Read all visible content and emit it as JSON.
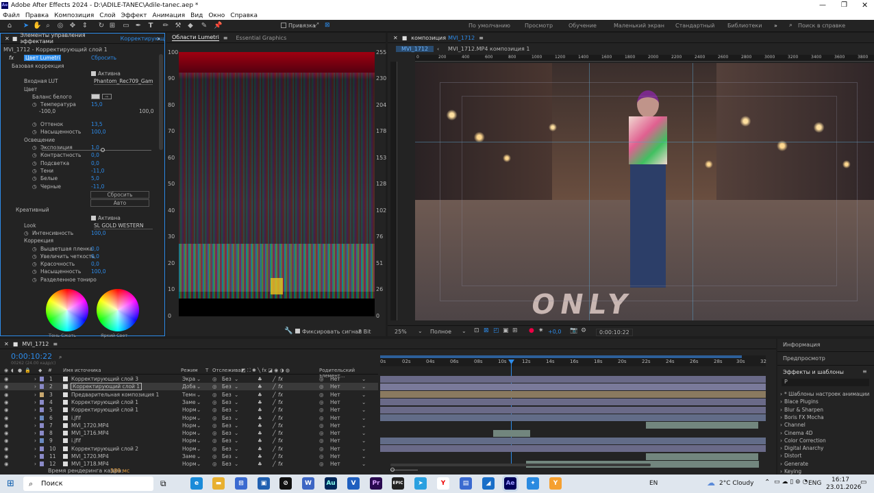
{
  "titlebar": {
    "title": "Adobe After Effects 2024 - D:\\ADILE-TANEC\\Adile-tanec.aep *"
  },
  "menu": [
    "Файл",
    "Правка",
    "Композиция",
    "Слой",
    "Эффект",
    "Анимация",
    "Вид",
    "Окно",
    "Справка"
  ],
  "toolbar": {
    "snap_label": "Привязка",
    "workspaces": [
      "По умолчанию",
      "Просмотр",
      "Обучение",
      "Маленький экран",
      "Стандартный",
      "Библиотеки"
    ],
    "help_placeholder": "Поиск в справке"
  },
  "effects_panel": {
    "tab": "Элементы управления эффектами",
    "tab_suffix": "Корректирующ",
    "layer": "MVI_1712 - Корректирующий слой 1",
    "effect_name": "Цвет Lumetri",
    "reset": "Сбросить",
    "basic": "Базовая коррекция",
    "active": "Активна",
    "input_lut": "Входная LUT",
    "lut_value": "Phantom_Rec709_Gam",
    "color": "Цвет",
    "white_balance": "Баланс белого",
    "temperature": "Температура",
    "temperature_val": "15,0",
    "range_min": "-100,0",
    "range_max": "100,0",
    "tint": "Оттенок",
    "tint_val": "13,5",
    "saturation": "Насыщенность",
    "saturation_val": "100,0",
    "lighting": "Освещение",
    "exposure": "Экспозиция",
    "exposure_val": "1,0",
    "contrast": "Контрастность",
    "contrast_val": "0,0",
    "highlights": "Подсветка",
    "highlights_val": "0,0",
    "shadows": "Тени",
    "shadows_val": "-11,0",
    "whites": "Белые",
    "whites_val": "5,0",
    "blacks": "Черные",
    "blacks_val": "-11,0",
    "reset_btn": "Сбросить",
    "auto_btn": "Авто",
    "creative": "Креативный",
    "active2": "Активна",
    "look": "Look",
    "look_val": "SL GOLD WESTERN",
    "intensity": "Интенсивность",
    "intensity_val": "100,0",
    "correction": "Коррекция",
    "faded": "Выцветшая пленка",
    "faded_val": "0,0",
    "sharpen": "Увеличить четкость",
    "sharpen_val": "0,0",
    "vibrance": "Красочность",
    "vibrance_val": "0,0",
    "saturation2": "Насыщенность",
    "saturation2_val": "100,0",
    "split": "Разделенное тониро",
    "wheel1": "Тень Сжать",
    "wheel2": "Яркий Свет"
  },
  "scopes": {
    "tabs": [
      "Области Lumetri",
      "Essential Graphics"
    ],
    "left_scale": [
      "100",
      "90",
      "80",
      "70",
      "60",
      "50",
      "40",
      "30",
      "20",
      "10",
      "0"
    ],
    "right_scale": [
      "255",
      "230",
      "204",
      "178",
      "153",
      "128",
      "102",
      "76",
      "51",
      "26",
      "0"
    ],
    "fix_signal": "Фиксировать сигнал",
    "bit": "8 Bit"
  },
  "comp": {
    "tab_prefix": "композиция",
    "tab_name": "MVI_1712",
    "crumb1": "MVI_1712",
    "crumb2": "MVI_1712.MP4 композиция 1",
    "ruler": [
      "0",
      "200",
      "400",
      "600",
      "800",
      "1000",
      "1200",
      "1400",
      "1600",
      "1800",
      "2000",
      "2200",
      "2400",
      "2600",
      "2800",
      "3000",
      "3200",
      "3400",
      "3600",
      "3800"
    ],
    "zoom": "25%",
    "quality": "Полное",
    "exposure": "+0,0",
    "time": "0:00:10:22",
    "sign": "ONLY"
  },
  "timeline": {
    "tab": "MVI_1712",
    "timecode": "0:00:10:22",
    "frames": "00262 (24.00 кадр/с)",
    "col_source": "Имя источника",
    "col_mode": "Режим",
    "col_t": "T",
    "col_track": "Отслежива...",
    "col_parent": "Родительский элемент...",
    "ruler": [
      "0s",
      "02s",
      "04s",
      "06s",
      "08s",
      "10s",
      "12s",
      "14s",
      "16s",
      "18s",
      "20s",
      "22s",
      "24s",
      "26s",
      "28s",
      "30s",
      "32"
    ],
    "layers": [
      {
        "num": "1",
        "name": "Корректирующий слой 3",
        "mode": "Экра",
        "track": "Без",
        "parent": "Нет"
      },
      {
        "num": "2",
        "name": "Корректирующий слой 1",
        "mode": "Доба",
        "track": "Без",
        "parent": "Нет"
      },
      {
        "num": "3",
        "name": "Предварительная композиция 1",
        "mode": "Темн",
        "track": "Без",
        "parent": "Нет"
      },
      {
        "num": "4",
        "name": "Корректирующий слой 1",
        "mode": "Заме",
        "track": "Без",
        "parent": "Нет"
      },
      {
        "num": "5",
        "name": "Корректирующий слой 1",
        "mode": "Норм",
        "track": "Без",
        "parent": "Нет"
      },
      {
        "num": "6",
        "name": "i.jfif",
        "mode": "Норм",
        "track": "Без",
        "parent": "Нет"
      },
      {
        "num": "7",
        "name": "MVI_1720.MP4",
        "mode": "Норм",
        "track": "Без",
        "parent": "Нет"
      },
      {
        "num": "8",
        "name": "MVI_1716.MP4",
        "mode": "Норм",
        "track": "Без",
        "parent": "Нет"
      },
      {
        "num": "9",
        "name": "i.jfif",
        "mode": "Норм",
        "track": "Без",
        "parent": "Нет"
      },
      {
        "num": "10",
        "name": "Корректирующий слой 2",
        "mode": "Норм",
        "track": "Без",
        "parent": "Нет"
      },
      {
        "num": "11",
        "name": "MVI_1720.MP4",
        "mode": "Заме",
        "track": "Без",
        "parent": "Нет"
      },
      {
        "num": "12",
        "name": "MVI_1718.MP4",
        "mode": "Норм",
        "track": "Без",
        "parent": "Нет"
      }
    ],
    "render_label": "Время рендеринга кадра:",
    "render_value": "589 мс"
  },
  "right_panel": {
    "info": "Информация",
    "preview": "Предпросмотр",
    "effects": "Эффекты и шаблоны",
    "search_placeholder": "Р",
    "items": [
      "* Шаблоны настроек анимации",
      "Blace Plugins",
      "Blur & Sharpen",
      "Boris FX Mocha",
      "Channel",
      "Cinema 4D",
      "Color Correction",
      "Digital Anarchy",
      "Distort",
      "Generate",
      "Keying"
    ]
  },
  "taskbar": {
    "search": "Поиск",
    "lang": "EN",
    "weather": "2°C Cloudy",
    "kbd": "ENG",
    "time": "16:17",
    "date": "23.01.2026"
  }
}
